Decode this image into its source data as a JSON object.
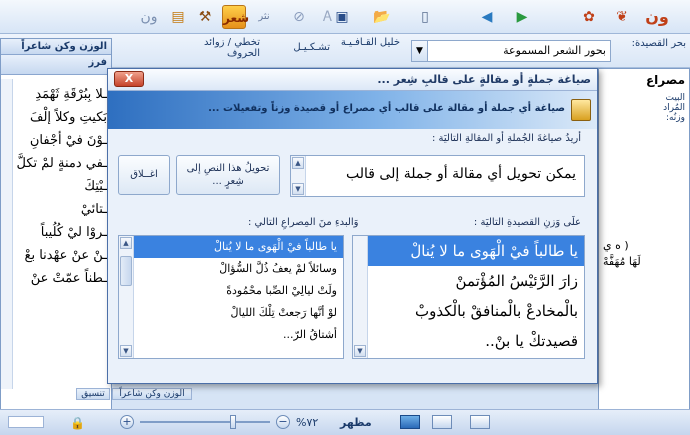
{
  "toolbar": {
    "shir_label": "شعر",
    "nasr_label": "نثر"
  },
  "ribbon": {
    "bahr_label": "بحر القصيدة:",
    "bahr_value": "بحور الشعر المسموعة",
    "khalil_label": "خليل القـافـيـة",
    "tashkeel_label": "تشـكـيـل",
    "takhtii_label": "تخطي / زوائد الحروف"
  },
  "left_panel": {
    "header": "الوزن وكن شاعراً",
    "sub_header": "فرز",
    "lines": [
      "ـلا بِبُرْقَةِ ثَهْمَدِ",
      "بَكيتِ وكلاً إلْفَ",
      "ـوْنَ فيْ أجْفانِ",
      "ـفي دمنةٍ لمْ تكلَّ",
      "ـيْتِكَ",
      "ـتائيْ",
      "ـروْا ليْ كُلُيباً",
      "ـنْ عنْ عهْدنا بعْ",
      "ـطناً عمّتْ عنْ"
    ],
    "tab1": "الوزن وكن شاعراً",
    "tab2": "تنسيق"
  },
  "right_panel": {
    "mesra_label": "مصراع",
    "bait_label": "البيت المُراد وزنُه:",
    "line1": "( ه ي",
    "line2": "لَهَا مُهَفَّهْ"
  },
  "dialog": {
    "title": "صياغة جملةٍ أو مقالةٍ على قالبِ شِعر ...",
    "close_label": "X",
    "banner": "صياغة أي جملة أو مقالة على قالب أي مصراع أو قصيدة وزناً وتفعيلات ...",
    "input_label": "أريدُ صياغةَ الجُملةِ أو المقالةِ التاليَة :",
    "input_value": "يمكن تحويل أي مقالة أو جملة إلى قالب",
    "convert_button": "تحويلُ هذا النصِ إلى شِعرٍ ...",
    "close_button": "اغــلاق",
    "poem_label": "علَى وَزنِ القصيدةِ التاليَة :",
    "start_label": "وَالبدءِ منَ المِصراعِ التالي :",
    "poem_items": [
      "يا طالباً فيْ الْهَوى ما لا يُنالْ",
      "زارَ الرَّئيْسُ المُؤْتمنْ",
      "بالْمخادعْ بالْمنافقْ بالْكذوبْ",
      "قصيدتكْ يا بنْ.."
    ],
    "verse_items": [
      "يا طالباً فيْ الْهَوى ما لا يُنالْ",
      "وسائلاً لمْ يعفُ ذُلَّ السُّؤالْ",
      "ولَتْ ليالِيْ الصِّبا محْمُودةً",
      "لوْ أنَّها رَجعتْ تِلْكَ الليالْ",
      "أشتاقُ الرّ..."
    ]
  },
  "statusbar": {
    "zoom": "%٧٢",
    "mode": "مظهر"
  }
}
